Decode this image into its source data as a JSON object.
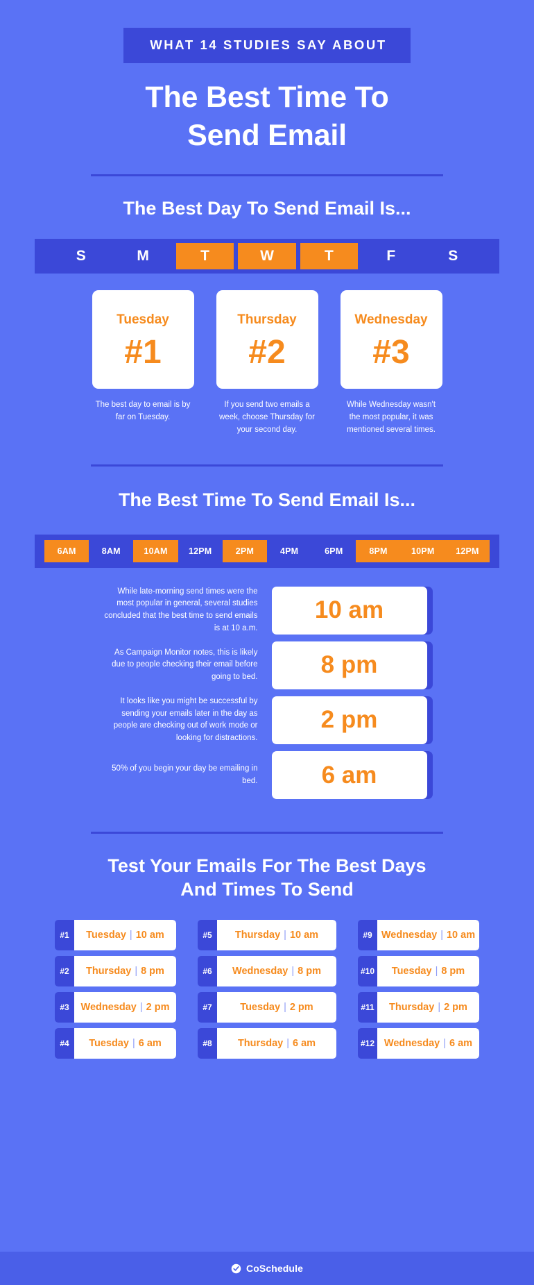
{
  "header": {
    "kicker": "WHAT 14 STUDIES SAY ABOUT",
    "title_line1": "The Best Time To",
    "title_line2": "Send Email"
  },
  "colors": {
    "background": "#5a72f5",
    "panel": "#3b48d8",
    "accent_orange": "#f68b1e",
    "card_white": "#ffffff",
    "footer": "#4a5fe8"
  },
  "day_section": {
    "heading": "The Best Day To Send Email Is...",
    "days": [
      {
        "letter": "S",
        "highlighted": false
      },
      {
        "letter": "M",
        "highlighted": false
      },
      {
        "letter": "T",
        "highlighted": true
      },
      {
        "letter": "W",
        "highlighted": true
      },
      {
        "letter": "T",
        "highlighted": true
      },
      {
        "letter": "F",
        "highlighted": false
      },
      {
        "letter": "S",
        "highlighted": false
      }
    ],
    "ranks": [
      {
        "day": "Tuesday",
        "rank": "#1",
        "caption": "The best day to email is by far on Tuesday."
      },
      {
        "day": "Thursday",
        "rank": "#2",
        "caption": "If you send two emails a week,  choose Thursday for your second day."
      },
      {
        "day": "Wednesday",
        "rank": "#3",
        "caption": "While Wednesday wasn't the most popular, it was mentioned several times."
      }
    ]
  },
  "time_section": {
    "heading": "The Best Time To Send Email Is...",
    "times": [
      {
        "label": "6AM",
        "highlighted": true
      },
      {
        "label": "8AM",
        "highlighted": false
      },
      {
        "label": "10AM",
        "highlighted": true
      },
      {
        "label": "12PM",
        "highlighted": false
      },
      {
        "label": "2PM",
        "highlighted": true
      },
      {
        "label": "4PM",
        "highlighted": false
      },
      {
        "label": "6PM",
        "highlighted": false
      },
      {
        "label": "8PM",
        "highlighted": true
      },
      {
        "label": "10PM",
        "highlighted": true
      },
      {
        "label": "12PM",
        "highlighted": true
      }
    ],
    "rows": [
      {
        "description": "While late-morning send times were the most popular in general, several studies concluded that the best time to send emails is at 10 a.m.",
        "time": "10 am"
      },
      {
        "description": "As Campaign Monitor notes, this is likely due to people checking their email before going to bed.",
        "time": "8 pm"
      },
      {
        "description": "It looks like you might be successful by sending your emails later in the day as people are checking out of work mode or looking for distractions.",
        "time": "2 pm"
      },
      {
        "description": "50% of you begin your day be emailing in bed.",
        "time": "6 am"
      }
    ]
  },
  "test_section": {
    "heading_line1": "Test Your Emails For The Best Days",
    "heading_line2": "And Times To Send",
    "columns": [
      [
        {
          "rank": "#1",
          "day": "Tuesday",
          "time": "10 am"
        },
        {
          "rank": "#2",
          "day": "Thursday",
          "time": "8 pm"
        },
        {
          "rank": "#3",
          "day": "Wednesday",
          "time": "2 pm"
        },
        {
          "rank": "#4",
          "day": "Tuesday",
          "time": "6 am"
        }
      ],
      [
        {
          "rank": "#5",
          "day": "Thursday",
          "time": "10 am"
        },
        {
          "rank": "#6",
          "day": "Wednesday",
          "time": "8 pm"
        },
        {
          "rank": "#7",
          "day": "Tuesday",
          "time": "2 pm"
        },
        {
          "rank": "#8",
          "day": "Thursday",
          "time": "6 am"
        }
      ],
      [
        {
          "rank": "#9",
          "day": "Wednesday",
          "time": "10 am"
        },
        {
          "rank": "#10",
          "day": "Tuesday",
          "time": "8 pm"
        },
        {
          "rank": "#11",
          "day": "Thursday",
          "time": "2 pm"
        },
        {
          "rank": "#12",
          "day": "Wednesday",
          "time": "6 am"
        }
      ]
    ],
    "separator": "|"
  },
  "footer": {
    "brand": "CoSchedule",
    "logo_icon": "coschedule-check-icon"
  }
}
